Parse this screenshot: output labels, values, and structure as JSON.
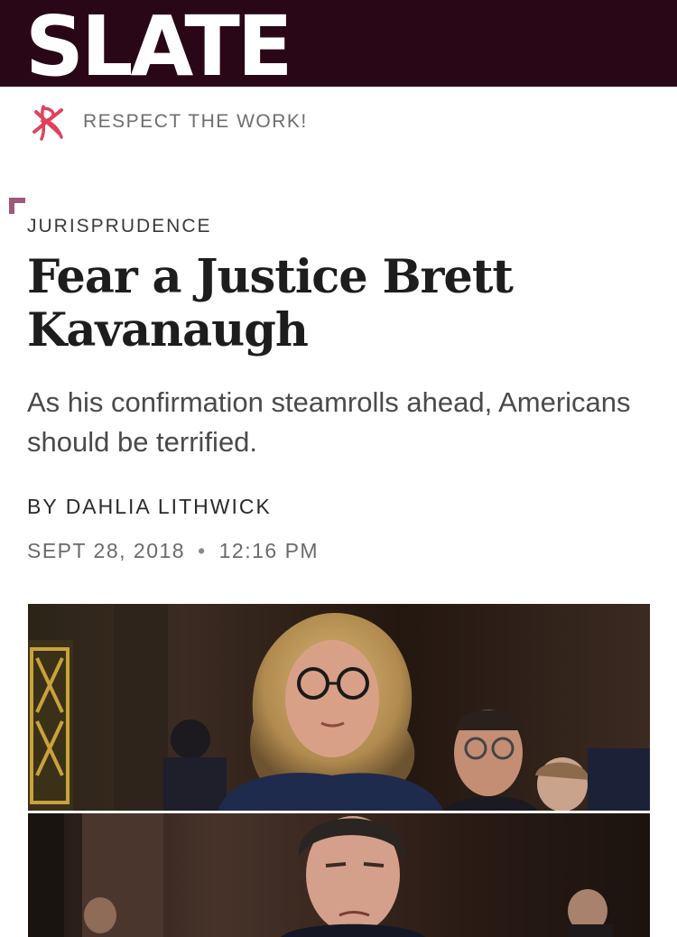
{
  "masthead": {
    "logo_text": "SLATE",
    "background_color": "#2a0716"
  },
  "promo": {
    "icon": "slate-plus-icon",
    "text": "RESPECT THE WORK!",
    "accent_color": "#e0425a"
  },
  "article": {
    "section": "JURISPRUDENCE",
    "headline": "Fear a Justice Brett Kavanaugh",
    "dek": "As his confirmation steamrolls ahead, Americans should be terrified.",
    "byline_prefix": "BY",
    "author": "DAHLIA LITHWICK",
    "date": "SEPT 28, 2018",
    "separator": "•",
    "time": "12:16 PM",
    "hero_image": "photo-collage-hearing"
  }
}
